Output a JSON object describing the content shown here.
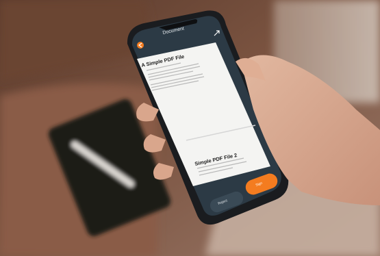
{
  "phone_screen": {
    "header": {
      "title": "Document",
      "back_icon": "back-arrow-icon",
      "expand_icon": "expand-icon"
    },
    "page_1": {
      "heading": "A Simple PDF File"
    },
    "page_2": {
      "heading": "Simple PDF File 2"
    },
    "footer": {
      "reject_label": "Reject",
      "sign_label": "Sign"
    }
  },
  "colors": {
    "accent": "#f47c20",
    "phone_panel": "#2c3a45",
    "background": "#6a4a3a"
  }
}
